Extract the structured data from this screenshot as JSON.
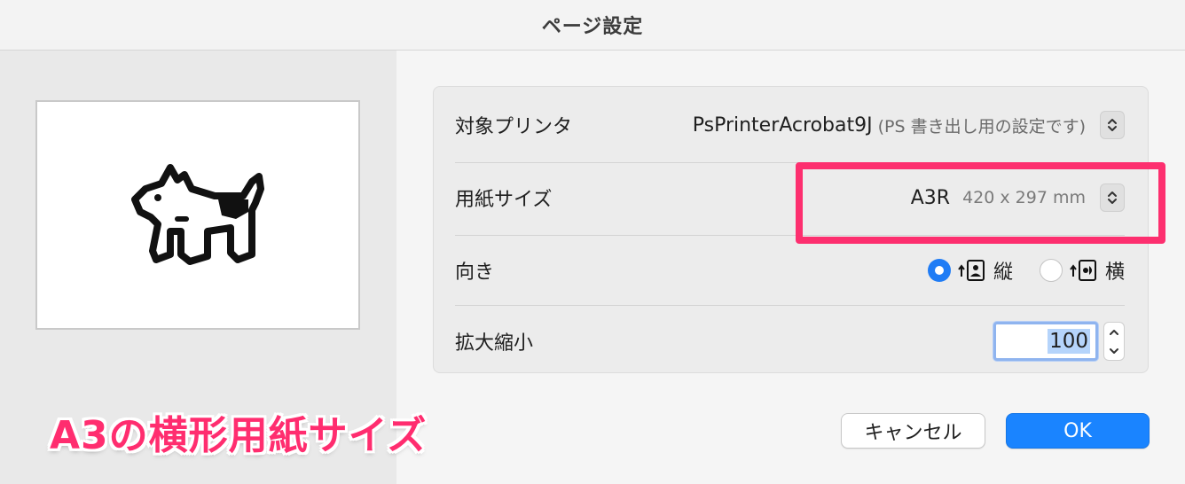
{
  "window": {
    "title": "ページ設定"
  },
  "settings": {
    "printer": {
      "label": "対象プリンタ",
      "name": "PsPrinterAcrobat9J",
      "note": "(PS 書き出し用の設定です)"
    },
    "paper": {
      "label": "用紙サイズ",
      "name": "A3R",
      "dimensions": "420 x 297 mm"
    },
    "orientation": {
      "label": "向き",
      "options": [
        {
          "label": "縦",
          "selected": true,
          "icon": "portrait-icon"
        },
        {
          "label": "横",
          "selected": false,
          "icon": "landscape-icon"
        }
      ]
    },
    "scale": {
      "label": "拡大縮小",
      "value": "100"
    }
  },
  "buttons": {
    "cancel": "キャンセル",
    "ok": "OK"
  },
  "annotation": {
    "caption": "A3の横形用紙サイズ",
    "color": "#fd2f6f"
  },
  "preview": {
    "icon": "dogcow-icon"
  },
  "colors": {
    "accent": "#1a84ff",
    "highlight": "#fd2f6f"
  }
}
